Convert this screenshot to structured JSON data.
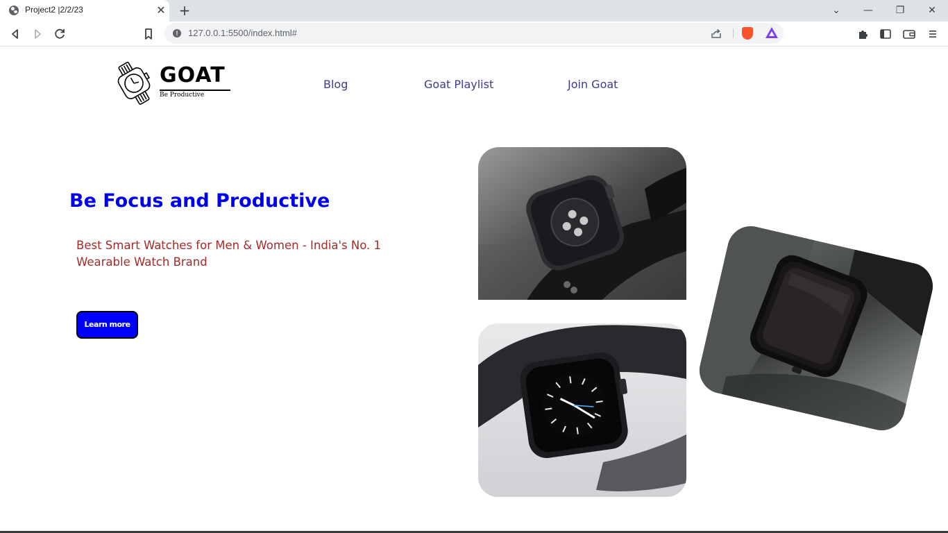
{
  "browser": {
    "tab_title": "Project2 |2/2/23",
    "tab_close": "✕",
    "new_tab": "+",
    "url": "127.0.0.1:5500/index.html#",
    "window_controls": {
      "dropdown": "⌄",
      "minimize": "—",
      "restore": "❐",
      "close": "✕"
    }
  },
  "site": {
    "logo": {
      "word": "GOAT",
      "tagline": "Be Productive"
    },
    "nav": [
      {
        "label": "Blog"
      },
      {
        "label": "Goat Playlist"
      },
      {
        "label": "Join Goat"
      }
    ],
    "hero": {
      "title": "Be Focus and Productive",
      "subtitle": "Best Smart Watches for Men & Women - India's No. 1 Wearable Watch Brand",
      "button": "Learn more"
    }
  },
  "colors": {
    "nav_link": "#3b3b8f",
    "hero_title": "#0000ee",
    "hero_subtitle": "#a52a2a",
    "button_bg": "#0000ff"
  }
}
